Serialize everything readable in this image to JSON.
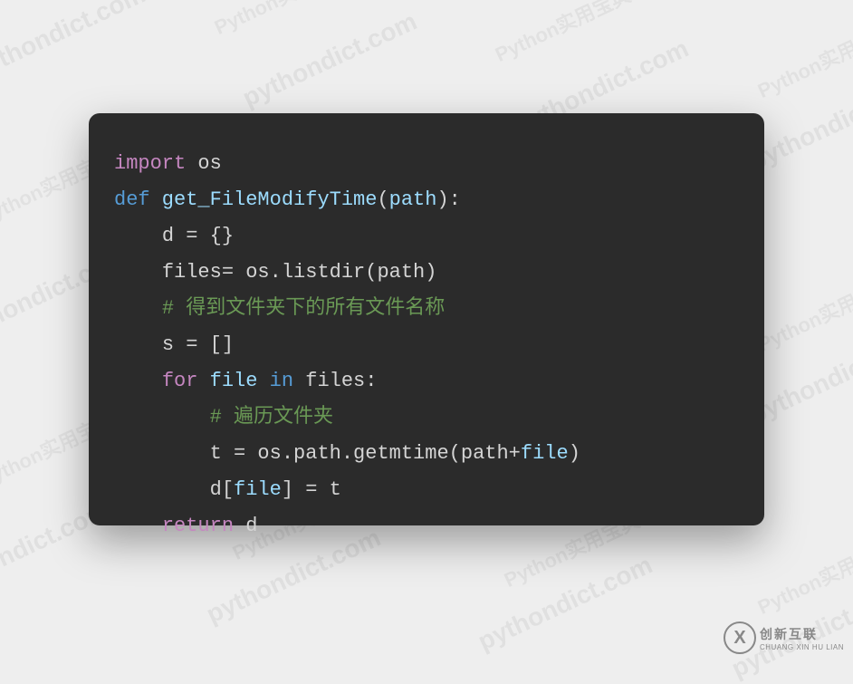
{
  "code": {
    "line1_kw_import": "import",
    "line1_mod": " os",
    "line2_kw_def": "def",
    "line2_fn": " get_FileModifyTime",
    "line2_paren_open": "(",
    "line2_param": "path",
    "line2_paren_close": "):",
    "line3_indent": "    ",
    "line3_text": "d = {}",
    "line4_indent": "    ",
    "line4_text": "files= os.listdir(path)",
    "line5_indent": "    ",
    "line5_comment": "# 得到文件夹下的所有文件名称",
    "line6_indent": "    ",
    "line6_text": "s = []",
    "line7_indent": "    ",
    "line7_for": "for",
    "line7_var": " file ",
    "line7_in": "in",
    "line7_rest": " files:",
    "line8_indent": "        ",
    "line8_comment": "# 遍历文件夹",
    "line9_indent": "        ",
    "line9_a": "t = os.path.getmtime(path+",
    "line9_b": "file",
    "line9_c": ")",
    "line10_indent": "        ",
    "line10_a": "d[",
    "line10_b": "file",
    "line10_c": "] = t",
    "line11_indent": "    ",
    "line11_return": "return",
    "line11_rest": " d"
  },
  "watermarks": {
    "text_en": "pythondict.com",
    "text_cn": "Python实用宝典"
  },
  "logo": {
    "glyph": "X",
    "cn": "创新互联",
    "en": "CHUANG XIN HU LIAN"
  }
}
